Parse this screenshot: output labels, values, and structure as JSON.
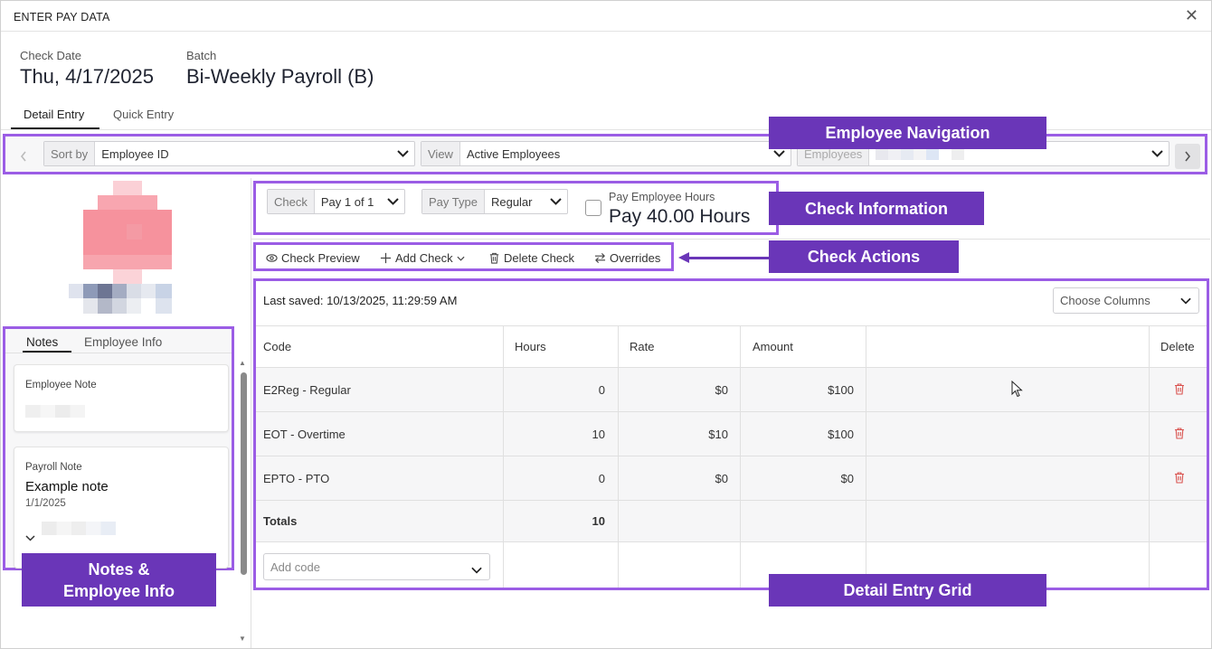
{
  "window": {
    "title": "ENTER PAY DATA"
  },
  "header": {
    "check_date_label": "Check Date",
    "check_date": "Thu, 4/17/2025",
    "batch_label": "Batch",
    "batch": "Bi-Weekly Payroll (B)"
  },
  "tabs": [
    {
      "label": "Detail Entry",
      "active": true
    },
    {
      "label": "Quick Entry",
      "active": false
    }
  ],
  "nav": {
    "sort_prefix": "Sort by",
    "sort_value": "Employee ID",
    "view_prefix": "View",
    "view_value": "Active Employees",
    "employees_prefix": "Employees",
    "prev_icon": "chevron-left-icon",
    "next_icon": "chevron-right-icon"
  },
  "check_info": {
    "check_prefix": "Check",
    "check_value": "Pay 1 of 1",
    "pay_type_prefix": "Pay Type",
    "pay_type_value": "Regular",
    "pay_hours_label": "Pay Employee Hours",
    "pay_hours_value": "Pay 40.00 Hours",
    "pay_hours_checked": false
  },
  "actions": {
    "check_preview": "Check Preview",
    "add_check": "Add Check",
    "delete_check": "Delete Check",
    "overrides": "Overrides"
  },
  "left_panel": {
    "tabs": [
      {
        "label": "Notes",
        "active": true
      },
      {
        "label": "Employee Info",
        "active": false
      }
    ],
    "employee_note_label": "Employee Note",
    "payroll_note_label": "Payroll Note",
    "payroll_note_title": "Example note",
    "payroll_note_date": "1/1/2025"
  },
  "grid": {
    "last_saved": "Last saved: 10/13/2025, 11:29:59 AM",
    "choose_columns": "Choose Columns",
    "headers": [
      "Code",
      "Hours",
      "Rate",
      "Amount",
      "",
      "Delete"
    ],
    "rows": [
      {
        "code": "E2Reg - Regular",
        "hours": "0",
        "rate": "$0",
        "amount": "$100"
      },
      {
        "code": "EOT - Overtime",
        "hours": "10",
        "rate": "$10",
        "amount": "$100"
      },
      {
        "code": "EPTO - PTO",
        "hours": "0",
        "rate": "$0",
        "amount": "$0"
      }
    ],
    "totals_label": "Totals",
    "totals_hours": "10",
    "add_code_placeholder": "Add code"
  },
  "callouts": {
    "employee_navigation": "Employee Navigation",
    "check_information": "Check Information",
    "check_actions": "Check Actions",
    "notes_info_line1": "Notes &",
    "notes_info_line2": "Employee Info",
    "detail_entry_grid": "Detail Entry Grid"
  },
  "colors": {
    "highlight_border": "#9b5de5",
    "callout_bg": "#6a36b8",
    "delete_icon": "#d9534f"
  }
}
